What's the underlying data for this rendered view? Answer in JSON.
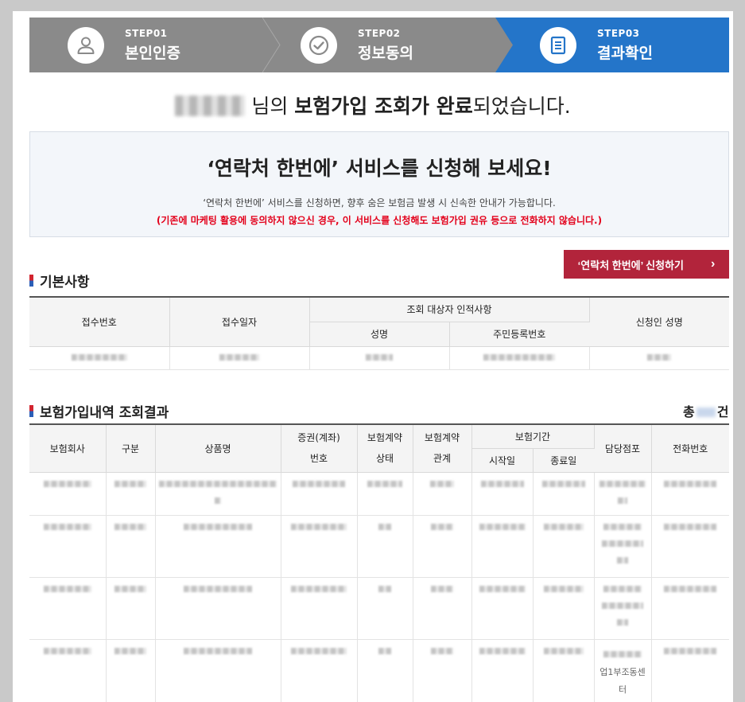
{
  "steps": [
    {
      "label": "STEP01",
      "title": "본인인증",
      "icon": "user-icon"
    },
    {
      "label": "STEP02",
      "title": "정보동의",
      "icon": "check-circle-icon"
    },
    {
      "label": "STEP03",
      "title": "결과확인",
      "icon": "document-icon"
    }
  ],
  "completion": {
    "suffix_1": "님의 ",
    "bold": "보험가입 조회가 완료",
    "suffix_2": "되었습니다."
  },
  "promo": {
    "title": "‘연락처 한번에’ 서비스를 신청해 보세요!",
    "desc": "‘연락처 한번에’ 서비스를 신청하면, 향후 숨은 보험금 발생 시 신속한 안내가 가능합니다.",
    "warning": "(기존에 마케팅 활용에 동의하지 않으신 경우, 이 서비스를 신청해도 보험가입 권유 등으로 전화하지 않습니다.)"
  },
  "apply_button": {
    "label": "‘연락처 한번에’ 신청하기",
    "arrow": "›"
  },
  "basic": {
    "title": "기본사항",
    "headers": {
      "receipt_no": "접수번호",
      "receipt_date": "접수일자",
      "target": "조회 대상자 인적사항",
      "name": "성명",
      "rrn": "주민등록번호",
      "applicant": "신청인 성명"
    }
  },
  "results": {
    "title": "보험가입내역 조회결과",
    "total_prefix": "총",
    "total_suffix": "건",
    "headers": {
      "company": "보험회사",
      "type": "구분",
      "product": "상품명",
      "policy_no_1": "증권(계좌)",
      "policy_no_2": "번호",
      "status_1": "보험계약",
      "status_2": "상태",
      "relation_1": "보험계약",
      "relation_2": "관계",
      "period": "보험기간",
      "start": "시작일",
      "end": "종료일",
      "branch": "담당점포",
      "phone": "전화번호"
    },
    "last_branch_text": "업1부조동센터"
  }
}
